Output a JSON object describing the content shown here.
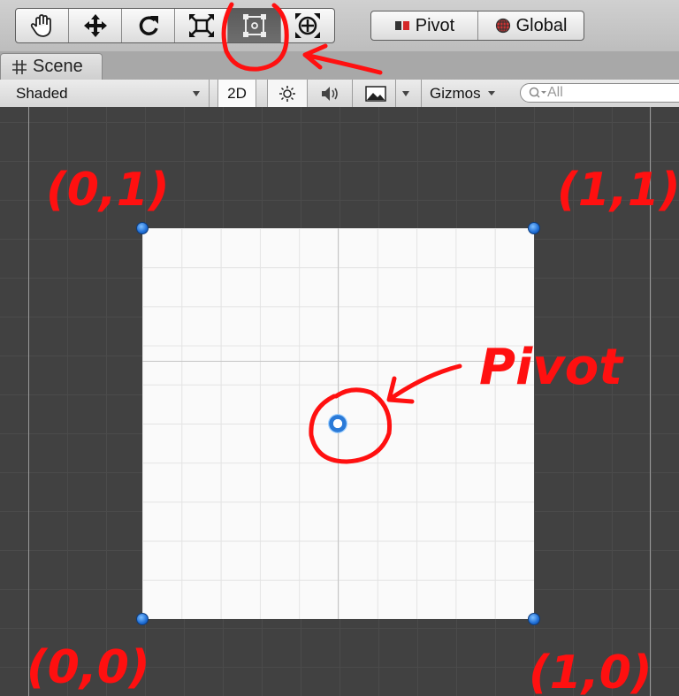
{
  "toolbar": {
    "tools": [
      "hand-icon",
      "move-icon",
      "rotate-icon",
      "scale-icon",
      "rect-tool-icon",
      "transform-tool-icon"
    ],
    "active_tool": "rect-tool-icon",
    "pivot_label": "Pivot",
    "global_label": "Global"
  },
  "tab": {
    "label": "Scene"
  },
  "scene_bar": {
    "shading": "Shaded",
    "mode_2d": "2D",
    "gizmos": "Gizmos",
    "search_placeholder": "All"
  },
  "annotations": {
    "top_left": "(0,1)",
    "top_right": "(1,1)",
    "bottom_left": "(0,0)",
    "bottom_right": "(1,0)",
    "pivot": "Pivot"
  },
  "colors": {
    "annotation": "#ff1010",
    "handle": "#1f6ed6",
    "scene_bg": "#414141"
  }
}
